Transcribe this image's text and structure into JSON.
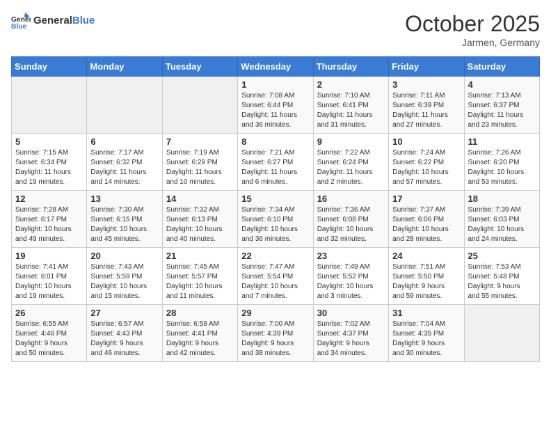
{
  "logo": {
    "general": "General",
    "blue": "Blue"
  },
  "header": {
    "month": "October 2025",
    "location": "Jarmen, Germany"
  },
  "weekdays": [
    "Sunday",
    "Monday",
    "Tuesday",
    "Wednesday",
    "Thursday",
    "Friday",
    "Saturday"
  ],
  "weeks": [
    [
      {
        "day": "",
        "info": ""
      },
      {
        "day": "",
        "info": ""
      },
      {
        "day": "",
        "info": ""
      },
      {
        "day": "1",
        "info": "Sunrise: 7:08 AM\nSunset: 6:44 PM\nDaylight: 11 hours\nand 36 minutes."
      },
      {
        "day": "2",
        "info": "Sunrise: 7:10 AM\nSunset: 6:41 PM\nDaylight: 11 hours\nand 31 minutes."
      },
      {
        "day": "3",
        "info": "Sunrise: 7:11 AM\nSunset: 6:39 PM\nDaylight: 11 hours\nand 27 minutes."
      },
      {
        "day": "4",
        "info": "Sunrise: 7:13 AM\nSunset: 6:37 PM\nDaylight: 11 hours\nand 23 minutes."
      }
    ],
    [
      {
        "day": "5",
        "info": "Sunrise: 7:15 AM\nSunset: 6:34 PM\nDaylight: 11 hours\nand 19 minutes."
      },
      {
        "day": "6",
        "info": "Sunrise: 7:17 AM\nSunset: 6:32 PM\nDaylight: 11 hours\nand 14 minutes."
      },
      {
        "day": "7",
        "info": "Sunrise: 7:19 AM\nSunset: 6:29 PM\nDaylight: 11 hours\nand 10 minutes."
      },
      {
        "day": "8",
        "info": "Sunrise: 7:21 AM\nSunset: 6:27 PM\nDaylight: 11 hours\nand 6 minutes."
      },
      {
        "day": "9",
        "info": "Sunrise: 7:22 AM\nSunset: 6:24 PM\nDaylight: 11 hours\nand 2 minutes."
      },
      {
        "day": "10",
        "info": "Sunrise: 7:24 AM\nSunset: 6:22 PM\nDaylight: 10 hours\nand 57 minutes."
      },
      {
        "day": "11",
        "info": "Sunrise: 7:26 AM\nSunset: 6:20 PM\nDaylight: 10 hours\nand 53 minutes."
      }
    ],
    [
      {
        "day": "12",
        "info": "Sunrise: 7:28 AM\nSunset: 6:17 PM\nDaylight: 10 hours\nand 49 minutes."
      },
      {
        "day": "13",
        "info": "Sunrise: 7:30 AM\nSunset: 6:15 PM\nDaylight: 10 hours\nand 45 minutes."
      },
      {
        "day": "14",
        "info": "Sunrise: 7:32 AM\nSunset: 6:13 PM\nDaylight: 10 hours\nand 40 minutes."
      },
      {
        "day": "15",
        "info": "Sunrise: 7:34 AM\nSunset: 6:10 PM\nDaylight: 10 hours\nand 36 minutes."
      },
      {
        "day": "16",
        "info": "Sunrise: 7:36 AM\nSunset: 6:08 PM\nDaylight: 10 hours\nand 32 minutes."
      },
      {
        "day": "17",
        "info": "Sunrise: 7:37 AM\nSunset: 6:06 PM\nDaylight: 10 hours\nand 28 minutes."
      },
      {
        "day": "18",
        "info": "Sunrise: 7:39 AM\nSunset: 6:03 PM\nDaylight: 10 hours\nand 24 minutes."
      }
    ],
    [
      {
        "day": "19",
        "info": "Sunrise: 7:41 AM\nSunset: 6:01 PM\nDaylight: 10 hours\nand 19 minutes."
      },
      {
        "day": "20",
        "info": "Sunrise: 7:43 AM\nSunset: 5:59 PM\nDaylight: 10 hours\nand 15 minutes."
      },
      {
        "day": "21",
        "info": "Sunrise: 7:45 AM\nSunset: 5:57 PM\nDaylight: 10 hours\nand 11 minutes."
      },
      {
        "day": "22",
        "info": "Sunrise: 7:47 AM\nSunset: 5:54 PM\nDaylight: 10 hours\nand 7 minutes."
      },
      {
        "day": "23",
        "info": "Sunrise: 7:49 AM\nSunset: 5:52 PM\nDaylight: 10 hours\nand 3 minutes."
      },
      {
        "day": "24",
        "info": "Sunrise: 7:51 AM\nSunset: 5:50 PM\nDaylight: 9 hours\nand 59 minutes."
      },
      {
        "day": "25",
        "info": "Sunrise: 7:53 AM\nSunset: 5:48 PM\nDaylight: 9 hours\nand 55 minutes."
      }
    ],
    [
      {
        "day": "26",
        "info": "Sunrise: 6:55 AM\nSunset: 4:46 PM\nDaylight: 9 hours\nand 50 minutes."
      },
      {
        "day": "27",
        "info": "Sunrise: 6:57 AM\nSunset: 4:43 PM\nDaylight: 9 hours\nand 46 minutes."
      },
      {
        "day": "28",
        "info": "Sunrise: 6:58 AM\nSunset: 4:41 PM\nDaylight: 9 hours\nand 42 minutes."
      },
      {
        "day": "29",
        "info": "Sunrise: 7:00 AM\nSunset: 4:39 PM\nDaylight: 9 hours\nand 38 minutes."
      },
      {
        "day": "30",
        "info": "Sunrise: 7:02 AM\nSunset: 4:37 PM\nDaylight: 9 hours\nand 34 minutes."
      },
      {
        "day": "31",
        "info": "Sunrise: 7:04 AM\nSunset: 4:35 PM\nDaylight: 9 hours\nand 30 minutes."
      },
      {
        "day": "",
        "info": ""
      }
    ]
  ]
}
